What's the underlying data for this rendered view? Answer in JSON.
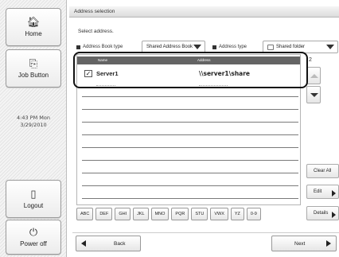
{
  "sidebar": {
    "home": {
      "label": "Home",
      "icon": "home-icon"
    },
    "job_button": {
      "label": "Job Button",
      "icon": "job-button-icon"
    },
    "clock": {
      "time": "4:43 PM Mon",
      "date": "3/29/2010"
    },
    "logout": {
      "label": "Logout",
      "icon": "logout-icon"
    },
    "power_off": {
      "label": "Power off",
      "icon": "power-icon"
    }
  },
  "header": {
    "title": "Address selection"
  },
  "instruction": "Select address.",
  "filters": {
    "address_book_type_label": "Address Book type",
    "address_book_type_value": "Shared Address Book",
    "address_type_label": "Address type",
    "address_type_value": "Shared folder"
  },
  "table": {
    "columns": [
      "Name",
      "Address"
    ],
    "rows": [
      {
        "name": "Server1",
        "address": "\\\\server1\\share",
        "checked": true
      }
    ]
  },
  "pager": {
    "page": "2"
  },
  "actions": {
    "clear_all": "Clear All",
    "edit": "Edit",
    "details": "Details"
  },
  "alpha_index": [
    "ABC",
    "DEF",
    "GHI",
    "JKL",
    "MNO",
    "PQR",
    "STU",
    "VWX",
    "YZ",
    "0-9"
  ],
  "nav": {
    "back": "Back",
    "next": "Next"
  },
  "colors": {
    "header_bg": "#646464",
    "highlight": "#111111"
  }
}
